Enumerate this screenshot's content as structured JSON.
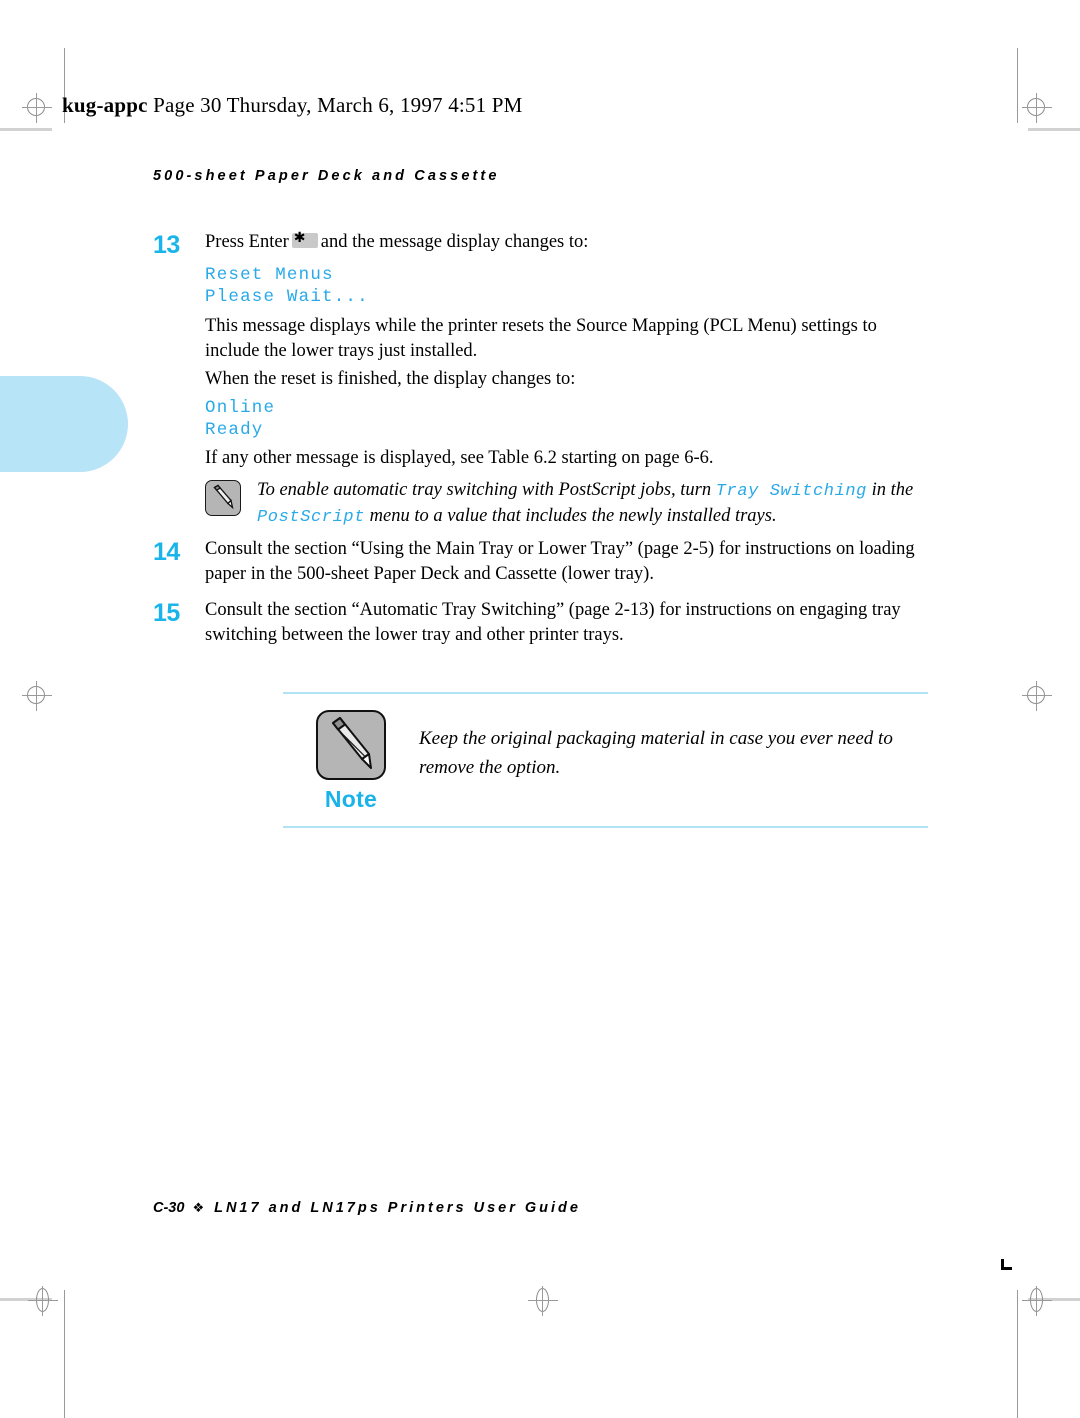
{
  "slug": {
    "file": "kug-appc",
    "rest": "Page 30  Thursday, March 6, 1997  4:51 PM"
  },
  "running_head": "500-sheet Paper Deck and Cassette",
  "steps": [
    {
      "number": "13",
      "text_before_key": "Press Enter",
      "key_icon": "asterisk-key",
      "text_after_key": "and the message display changes to:",
      "display_lines": [
        "Reset Menus",
        "Please Wait..."
      ]
    },
    {
      "number": "14",
      "text": "Consult the section “Using the Main Tray or Lower Tray” (page 2-5) for instructions on loading paper in the 500-sheet Paper Deck and Cassette (lower tray)."
    },
    {
      "number": "15",
      "text": "Consult the section “Automatic Tray Switching” (page 2-13) for instructions on engaging tray switching between the lower tray and other printer trays."
    }
  ],
  "paragraphs": {
    "p1_line1": "This message displays while the printer resets the Source Mapping (PCL Menu) settings to",
    "p1_line2": "include the lower trays just installed.",
    "p2": "When the reset is finished, the display changes to:",
    "display_lines_2": [
      "Online",
      "Ready"
    ],
    "p3": "If any other message is displayed, see Table 6.2 starting on page 6-6."
  },
  "inline_note": {
    "icon": "pencil-icon",
    "seg1": "To enable automatic tray switching with PostScript jobs, turn ",
    "mono1": "Tray Switching",
    "seg2": " in the",
    "mono2": "PostScript",
    "seg3": " menu to a value that includes the newly installed trays."
  },
  "callout": {
    "icon": "pencil-icon",
    "label": "Note",
    "line1": "Keep the original packaging material in case you ever need to",
    "line2": "remove the option."
  },
  "footer": {
    "page": "C-30",
    "divider": "❖",
    "title": "LN17 and LN17ps Printers User Guide"
  },
  "colors": {
    "accent_cyan": "#18b4ea",
    "rule_cyan": "#b0e4f5",
    "tab_blue": "#b8e4f8",
    "icon_grey": "#b5b5b5"
  }
}
